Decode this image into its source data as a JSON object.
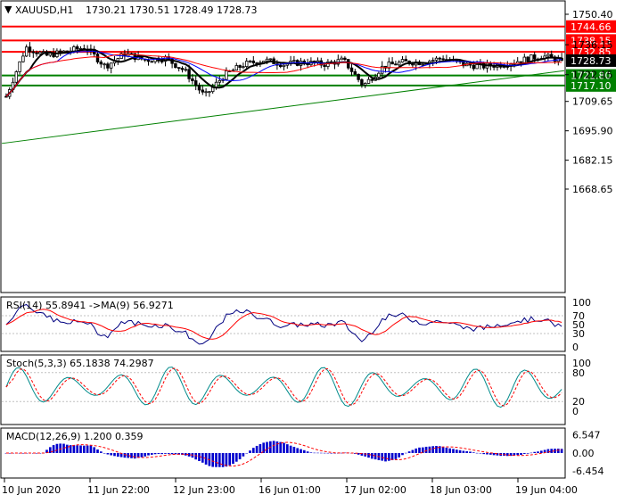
{
  "header": {
    "symbol_marker": "▼",
    "symbol": "XAUUSD,H1",
    "ohlc": "1730.21 1730.51 1728.49 1728.73"
  },
  "main_panel": {
    "price_ticks": [
      "1750.40",
      "1736.15",
      "1722.15",
      "1709.65",
      "1695.90",
      "1682.15",
      "1668.65"
    ],
    "price_tick_values": [
      1750.4,
      1736.15,
      1722.15,
      1709.65,
      1695.9,
      1682.15,
      1668.65
    ],
    "levels": [
      {
        "label": "1744.66",
        "value": 1744.66,
        "color": "#ff0000",
        "text_color": "#ffffff"
      },
      {
        "label": "1738.15",
        "value": 1738.15,
        "color": "#ff0000",
        "text_color": "#ffffff"
      },
      {
        "label": "1732.85",
        "value": 1732.85,
        "color": "#ff0000",
        "text_color": "#ffffff"
      },
      {
        "label": "1721.80",
        "value": 1721.8,
        "color": "#008000",
        "text_color": "#ffffff"
      },
      {
        "label": "1717.10",
        "value": 1717.1,
        "color": "#008000",
        "text_color": "#ffffff"
      }
    ],
    "current_price": {
      "label": "1728.73",
      "value": 1728.73,
      "color": "#000000",
      "text_color": "#ffffff"
    }
  },
  "rsi_panel": {
    "label": "RSI(14) 55.8941  ->MA(9) 56.9271",
    "ticks": [
      "100",
      "70",
      "50",
      "30",
      "0"
    ],
    "tick_values": [
      100,
      70,
      50,
      30,
      0
    ]
  },
  "stoch_panel": {
    "label": "Stoch(5,3,3) 65.1838 74.2987",
    "ticks": [
      "100",
      "80",
      "20",
      "0"
    ],
    "tick_values": [
      100,
      80,
      20,
      0
    ]
  },
  "macd_panel": {
    "label": "MACD(12,26,9) 1.200 0.359",
    "ticks": [
      "6.547",
      "0.00",
      "-6.454"
    ],
    "tick_values": [
      6.547,
      0,
      -6.454
    ]
  },
  "time_axis": {
    "labels": [
      "10 Jun 2020",
      "11 Jun 22:00",
      "12 Jun 23:00",
      "16 Jun 01:00",
      "17 Jun 02:00",
      "18 Jun 03:00",
      "19 Jun 04:00"
    ]
  },
  "colors": {
    "candles": "#000000",
    "ma_fast": "#000000",
    "ma_mid": "#0000ff",
    "ma_slow": "#ff0000",
    "trendline": "#008000",
    "rsi_line": "#000080",
    "rsi_signal": "#ff0000",
    "stoch_main": "#008b8b",
    "stoch_signal": "#ff0000",
    "macd_histogram": "#0000cd",
    "macd_signal": "#ff0000"
  },
  "chart_data": {
    "type": "line",
    "title": "XAUUSD,H1",
    "ylim": [
      1661.5,
      1754
    ],
    "x": [
      "10 Jun 2020",
      "11 Jun 22:00",
      "12 Jun 23:00",
      "16 Jun 01:00",
      "17 Jun 02:00",
      "18 Jun 03:00",
      "19 Jun 04:00"
    ],
    "series": [
      {
        "name": "close",
        "values": [
          1712,
          1735,
          1731,
          1733,
          1735,
          1726,
          1732,
          1729,
          1730,
          1724,
          1712,
          1722,
          1727,
          1729,
          1727,
          1728,
          1727,
          1729,
          1717,
          1726,
          1728,
          1728,
          1730,
          1727,
          1726,
          1727,
          1729,
          1731,
          1728.73
        ]
      }
    ],
    "horizontal_levels": [
      1744.66,
      1738.15,
      1732.85,
      1721.8,
      1717.1
    ],
    "trendline": {
      "from": [
        "10 Jun 2020",
        1690
      ],
      "to": [
        "19 Jun 04:00",
        1724
      ]
    },
    "grid": false
  }
}
